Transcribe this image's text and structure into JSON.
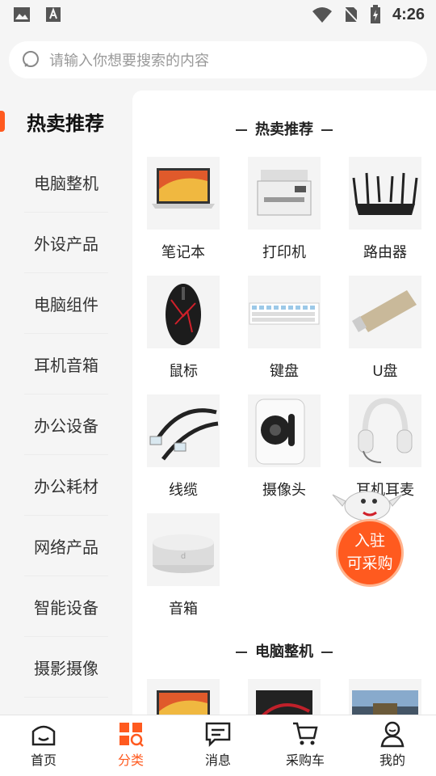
{
  "status_bar": {
    "time": "4:26"
  },
  "search": {
    "placeholder": "请输入你想要搜索的内容"
  },
  "sidebar": {
    "header": "热卖推荐",
    "items": [
      {
        "label": "电脑整机"
      },
      {
        "label": "外设产品"
      },
      {
        "label": "电脑组件"
      },
      {
        "label": "耳机音箱"
      },
      {
        "label": "办公设备"
      },
      {
        "label": "办公耗材"
      },
      {
        "label": "网络产品"
      },
      {
        "label": "智能设备"
      },
      {
        "label": "摄影摄像"
      }
    ]
  },
  "sections": [
    {
      "title": "热卖推荐",
      "products": [
        {
          "label": "笔记本",
          "icon": "laptop"
        },
        {
          "label": "打印机",
          "icon": "printer"
        },
        {
          "label": "路由器",
          "icon": "router"
        },
        {
          "label": "鼠标",
          "icon": "mouse"
        },
        {
          "label": "键盘",
          "icon": "keyboard"
        },
        {
          "label": "U盘",
          "icon": "usb-drive"
        },
        {
          "label": "线缆",
          "icon": "cable"
        },
        {
          "label": "摄像头",
          "icon": "camera"
        },
        {
          "label": "耳机耳麦",
          "icon": "headset"
        },
        {
          "label": "音箱",
          "icon": "speaker"
        }
      ]
    },
    {
      "title": "电脑整机",
      "products": [
        {
          "label": "",
          "icon": "laptop"
        },
        {
          "label": "",
          "icon": "monitor"
        },
        {
          "label": "",
          "icon": "game-monitor"
        }
      ]
    }
  ],
  "float_badge": {
    "line1": "入驻",
    "line2": "可采购"
  },
  "tabs": [
    {
      "label": "首页",
      "icon": "home-icon",
      "active": false
    },
    {
      "label": "分类",
      "icon": "category-icon",
      "active": true
    },
    {
      "label": "消息",
      "icon": "message-icon",
      "active": false
    },
    {
      "label": "采购车",
      "icon": "cart-icon",
      "active": false
    },
    {
      "label": "我的",
      "icon": "user-icon",
      "active": false
    }
  ],
  "colors": {
    "accent": "#ff5a1f",
    "background": "#f5f5f5"
  }
}
